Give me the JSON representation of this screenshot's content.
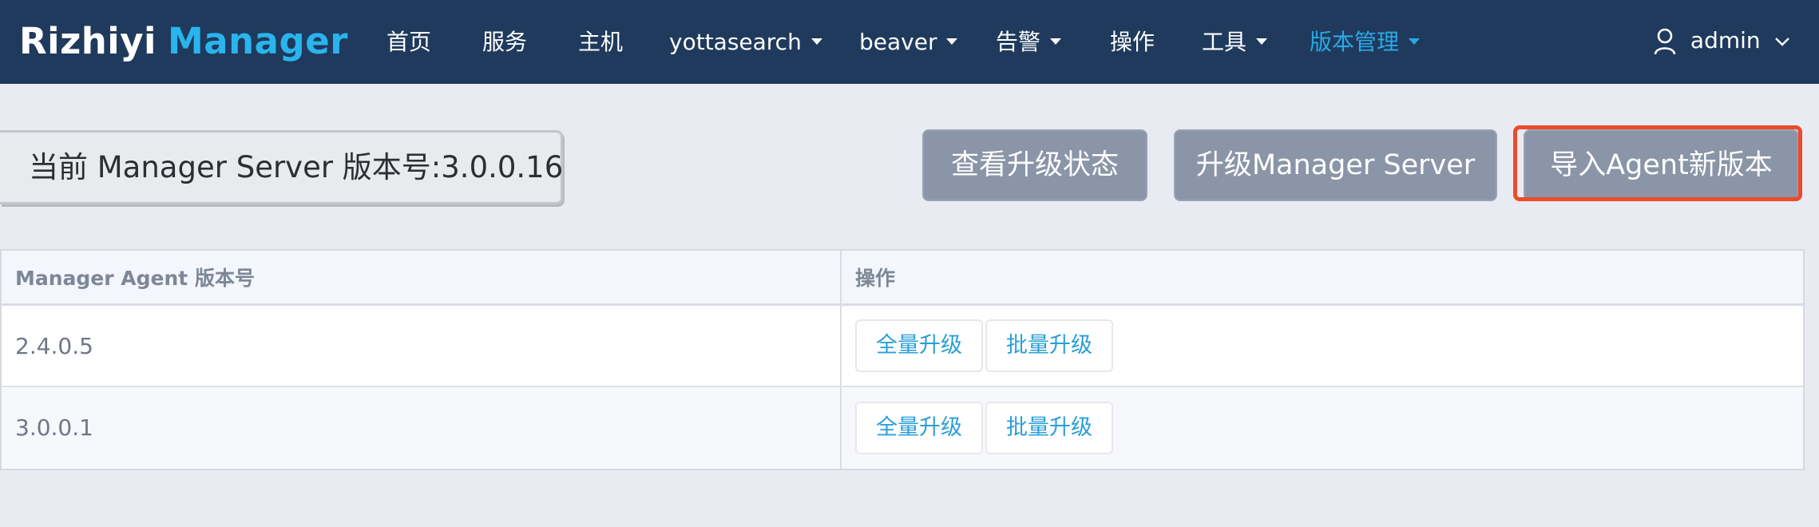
{
  "brand": {
    "part1": "Rizhiyi",
    "part2": "Manager",
    "accent_color": "#29b4ee"
  },
  "nav": {
    "items": [
      {
        "label": "首页",
        "dropdown": false,
        "active": false
      },
      {
        "label": "服务",
        "dropdown": false,
        "active": false
      },
      {
        "label": "主机",
        "dropdown": false,
        "active": false
      },
      {
        "label": "yottasearch",
        "dropdown": true,
        "active": false
      },
      {
        "label": "beaver",
        "dropdown": true,
        "active": false
      },
      {
        "label": "告警",
        "dropdown": true,
        "active": false
      },
      {
        "label": "操作",
        "dropdown": false,
        "active": false
      },
      {
        "label": "工具",
        "dropdown": true,
        "active": false
      },
      {
        "label": "版本管理",
        "dropdown": true,
        "active": true
      }
    ],
    "user": {
      "name": "admin",
      "icon": "user-icon"
    }
  },
  "version": {
    "text": "当前 Manager Server 版本号:3.0.0.16"
  },
  "actions": {
    "view_status": "查看升级状态",
    "upgrade_server": "升级Manager Server",
    "import_agent": "导入Agent新版本",
    "highlight_color": "#ec4a2c"
  },
  "table": {
    "headers": [
      "Manager Agent 版本号",
      "操作"
    ],
    "rows": [
      {
        "version": "2.4.0.5",
        "ops": [
          "全量升级",
          "批量升级"
        ]
      },
      {
        "version": "3.0.0.1",
        "ops": [
          "全量升级",
          "批量升级"
        ]
      }
    ]
  }
}
